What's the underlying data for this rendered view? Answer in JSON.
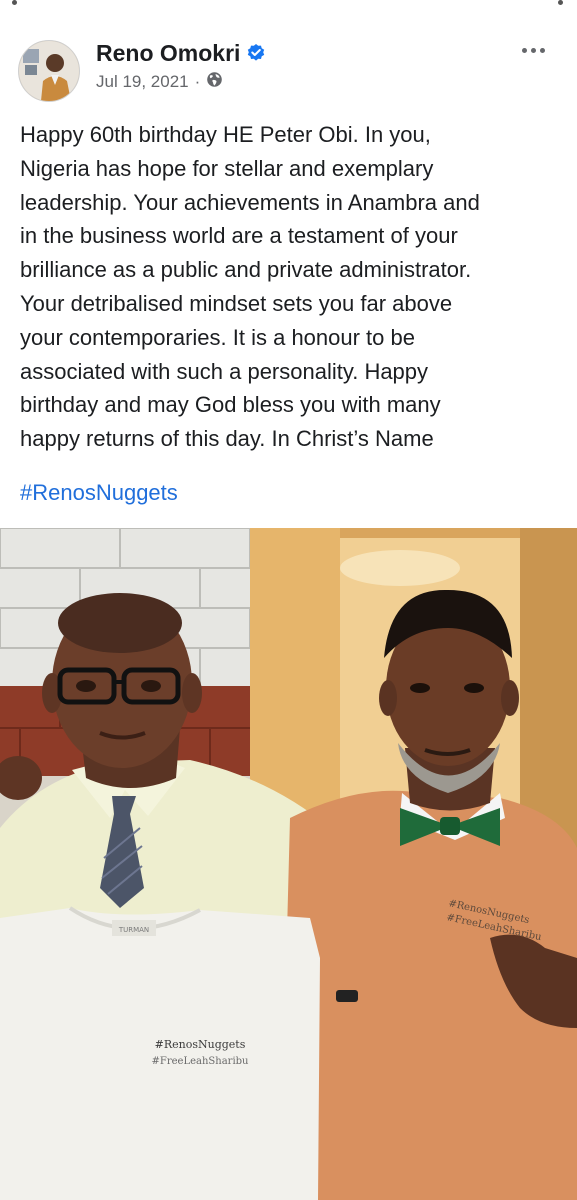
{
  "post": {
    "author": "Reno Omokri",
    "date": "Jul 19, 2021",
    "meta_separator": "·",
    "text": "Happy 60th birthday HE Peter Obi. In you,\nNigeria has hope for stellar and exemplary\nleadership. Your achievements in Anambra and\nin the business world are a testament of your\nbrilliance as a public and private administrator.\nYour detribalised mindset sets you far above\nyour contemporaries. It is a honour to be\nassociated with such a personality. Happy\nbirthday and may God bless you with many\nhappy returns of this day. In Christ’s Name",
    "hashtag": "#RenosNuggets"
  },
  "photo": {
    "shirt_print_line1": "#RenosNuggets",
    "shirt_print_line2": "#FreeLeahSharibu",
    "sweater_print_line1": "#RenosNuggets",
    "sweater_print_line2": "#FreeLeahSharibu",
    "label_text": "TURMAN"
  },
  "icons": {
    "verified": "verified-badge-icon",
    "audience": "globe-icon",
    "menu": "more-options-icon"
  },
  "colors": {
    "text": "#1c1e21",
    "secondary": "#65676b",
    "link": "#216fdb",
    "verified": "#1877f2"
  }
}
